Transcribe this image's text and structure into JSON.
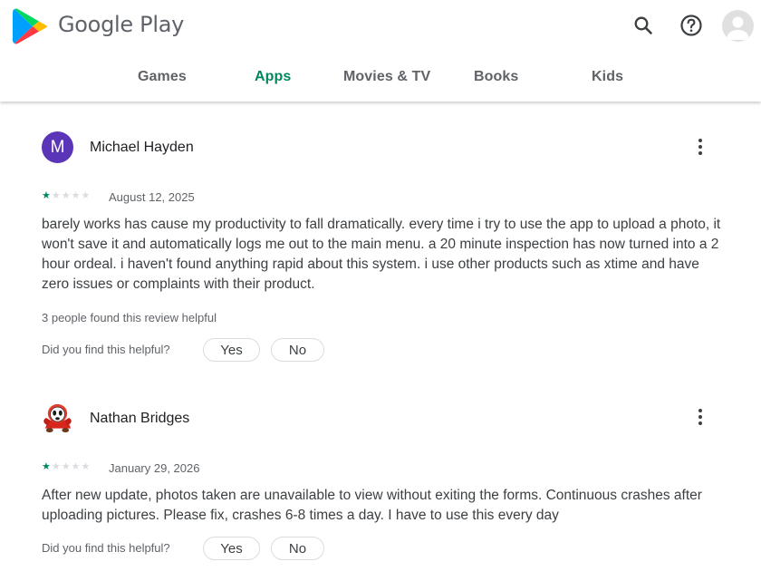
{
  "header": {
    "brand": "Google Play",
    "icons": [
      "search-icon",
      "help-icon",
      "account-icon"
    ]
  },
  "nav": {
    "tabs": [
      {
        "label": "Games",
        "active": false
      },
      {
        "label": "Apps",
        "active": true
      },
      {
        "label": "Movies & TV",
        "active": false
      },
      {
        "label": "Books",
        "active": false
      },
      {
        "label": "Kids",
        "active": false
      }
    ]
  },
  "reviews": [
    {
      "avatar_letter": "M",
      "name": "Michael Hayden",
      "rating": 1,
      "date": "August 12, 2025",
      "text": "barely works has cause my productivity to fall dramatically. every time i try to use the app to upload a photo, it won't save it and automatically logs me out to the main menu. a 20 minute inspection has now turned into a 2 hour ordeal. i haven't found anything rapid about this system. i use other products such as xtime and have zero issues or complaints with their product.",
      "helpful_count": "3 people found this review helpful",
      "helpful_question": "Did you find this helpful?",
      "yes_label": "Yes",
      "no_label": "No"
    },
    {
      "avatar_icon": "character-avatar-icon",
      "name": "Nathan Bridges",
      "rating": 1,
      "date": "January 29, 2026",
      "text": "After new update, photos taken are unavailable to view without exiting the forms. Continuous crashes after uploading pictures. Please fix, crashes 6-8 times a day. I have to use this every day",
      "helpful_question": "Did you find this helpful?",
      "yes_label": "Yes",
      "no_label": "No"
    }
  ],
  "colors": {
    "accent": "#01875f",
    "avatar_purple": "#5a35b7",
    "text_secondary": "#5f6368"
  }
}
